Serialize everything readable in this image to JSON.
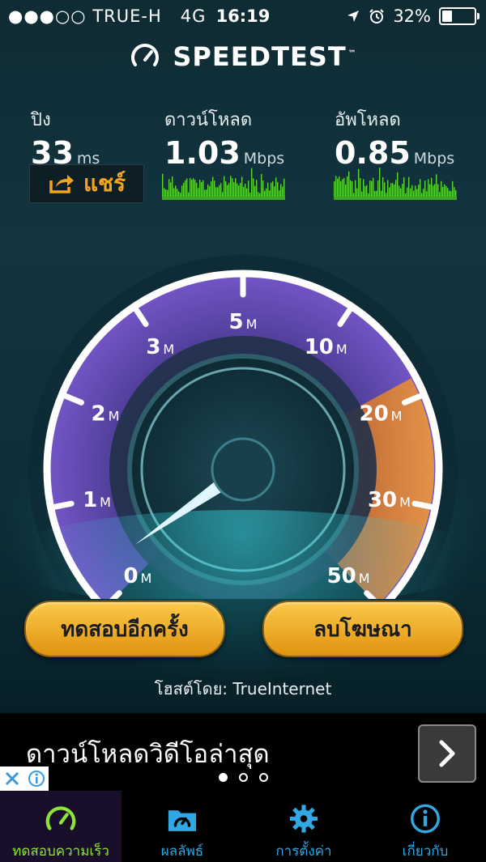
{
  "status_bar": {
    "signal": "●●●○○",
    "carrier": "TRUE-H",
    "network": "4G",
    "time": "16:19",
    "battery": "32%",
    "battery_level": 0.32
  },
  "app": {
    "title": "SPEEDTEST",
    "trademark": "™"
  },
  "metrics": {
    "ping": {
      "label": "ปิง",
      "value": "33",
      "unit": "ms"
    },
    "download": {
      "label": "ดาวน์โหลด",
      "value": "1.03",
      "unit": "Mbps"
    },
    "upload": {
      "label": "อัพโหลด",
      "value": "0.85",
      "unit": "Mbps"
    }
  },
  "share": {
    "label": "แชร์",
    "icon": "share-icon"
  },
  "gauge": {
    "ticks": [
      {
        "num": "0",
        "suffix": "M"
      },
      {
        "num": "1",
        "suffix": "M"
      },
      {
        "num": "2",
        "suffix": "M"
      },
      {
        "num": "3",
        "suffix": "M"
      },
      {
        "num": "5",
        "suffix": "M"
      },
      {
        "num": "10",
        "suffix": "M"
      },
      {
        "num": "20",
        "suffix": "M"
      },
      {
        "num": "30",
        "suffix": "M"
      },
      {
        "num": "50",
        "suffix": "M"
      }
    ],
    "needle_value_mbps": 0.3,
    "accent_purple": "#7b5ad0",
    "accent_orange": "#e5812c"
  },
  "buttons": {
    "test_again": "ทดสอบอีกครั้ง",
    "remove_ads": "ลบโฆษณา"
  },
  "host": {
    "label": "โฮสต์โดย: TrueInternet"
  },
  "ad": {
    "text": "ดาวน์โหลดวิดีโอล่าสุด",
    "arrow": "›",
    "page_index": 0,
    "page_count": 3
  },
  "tabs": [
    {
      "label": "ทดสอบความเร็ว",
      "icon": "speedometer-icon",
      "active": true
    },
    {
      "label": "ผลลัพธ์",
      "icon": "results-folder-icon",
      "active": false
    },
    {
      "label": "การตั้งค่า",
      "icon": "gear-icon",
      "active": false
    },
    {
      "label": "เกี่ยวกับ",
      "icon": "info-icon",
      "active": false
    }
  ],
  "colors": {
    "tab_active": "#8de33a",
    "tab_inactive": "#31a7e3",
    "share_accent": "#f3a521",
    "button_gold": "#f2b030"
  }
}
